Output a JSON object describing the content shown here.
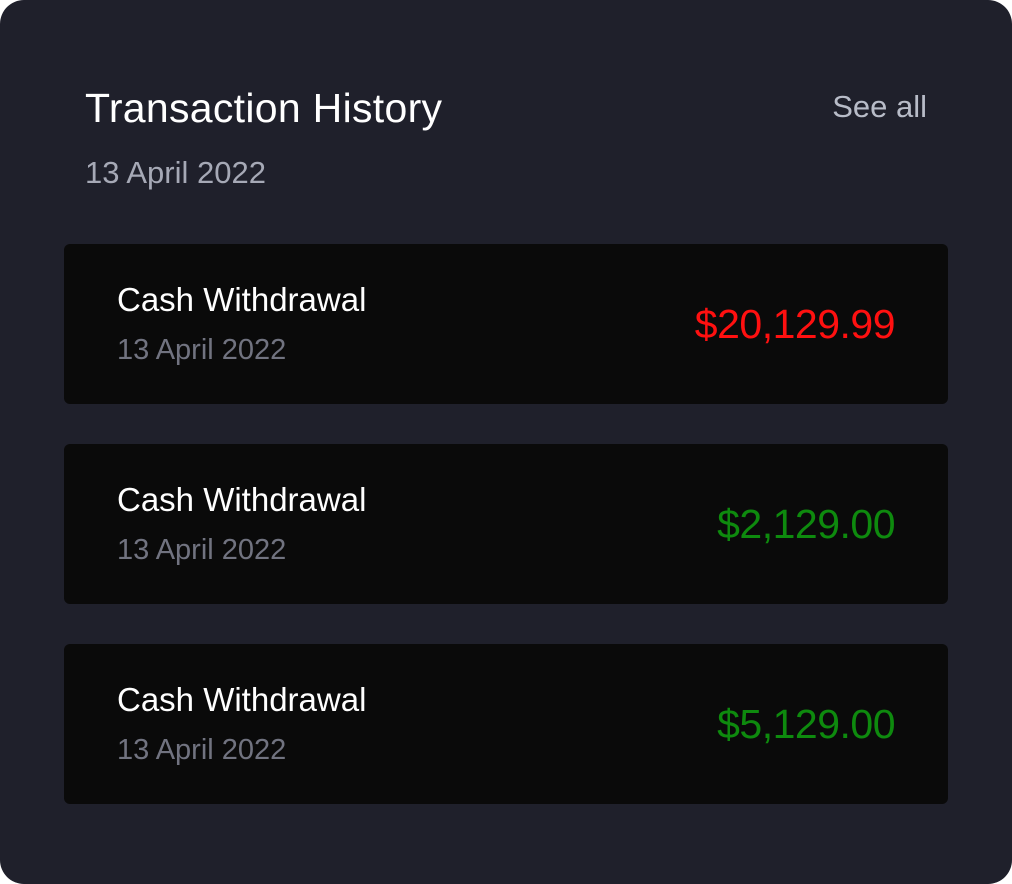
{
  "header": {
    "title": "Transaction History",
    "see_all_label": "See all",
    "date": "13 April 2022"
  },
  "transactions": [
    {
      "name": "Cash Withdrawal",
      "date": "13 April 2022",
      "amount": "$20,129.99",
      "amount_color": "#ff1010"
    },
    {
      "name": "Cash Withdrawal",
      "date": "13 April 2022",
      "amount": "$2,129.00",
      "amount_color": "#0e8a0e"
    },
    {
      "name": "Cash Withdrawal",
      "date": "13 April 2022",
      "amount": "$5,129.00",
      "amount_color": "#0e8a0e"
    }
  ],
  "colors": {
    "card_background": "#1f202b",
    "row_background": "#0a0a0a",
    "debit": "#ff1010",
    "credit": "#0e8a0e"
  }
}
